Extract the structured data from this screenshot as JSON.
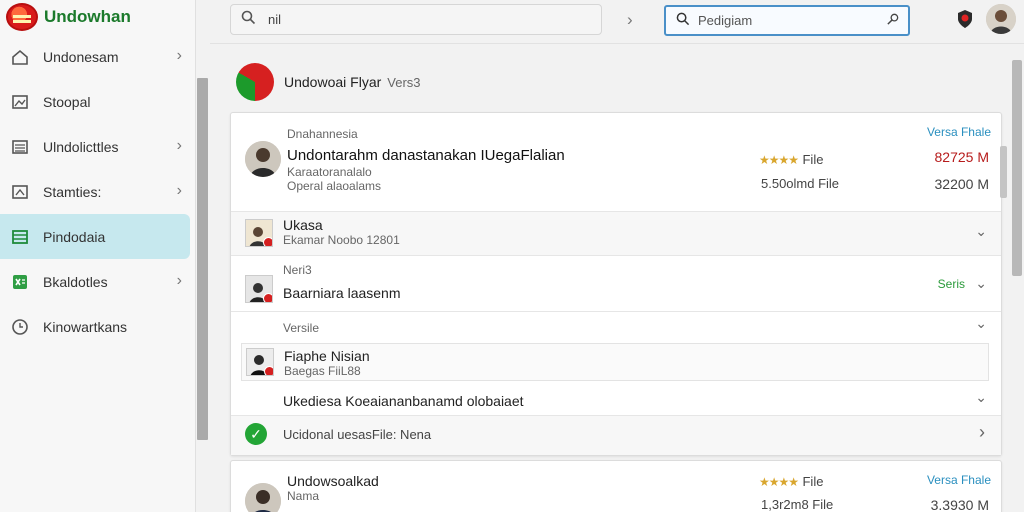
{
  "app": {
    "name": "Undowhan"
  },
  "sidebar": {
    "items": [
      {
        "label": "Undonesam",
        "icon": "home-icon",
        "chevron": true
      },
      {
        "label": "Stoopal",
        "icon": "image-icon",
        "chevron": false
      },
      {
        "label": "Ulndolicttles",
        "icon": "list-icon",
        "chevron": true
      },
      {
        "label": "Stamties:",
        "icon": "photo-icon",
        "chevron": true
      },
      {
        "label": "Pindodaia",
        "icon": "table-icon",
        "chevron": false,
        "active": true
      },
      {
        "label": "Bkaldotles",
        "icon": "spreadsheet-icon",
        "chevron": true
      },
      {
        "label": "Kinowartkans",
        "icon": "clock-icon",
        "chevron": false
      }
    ]
  },
  "topbar": {
    "search_left_value": "nil",
    "search_right_value": "Pedigiam"
  },
  "header": {
    "title": "Undowoai Flyar",
    "version": "Vers3"
  },
  "card1": {
    "top": {
      "small_title": "Dnahannesia",
      "main_title": "Undontarahm danastanakan IUegaFlalian",
      "sub1": "Karaatoranalalo",
      "sub2": "Operal alaoalams",
      "rating_label": "File",
      "size_label": "5.50olmd File",
      "version_link": "Versa Fhale",
      "red_value": "82725 M",
      "grey_value": "32200 M"
    },
    "row1": {
      "title": "Ukasa",
      "sub": "Ekamar Noobo 12801"
    },
    "row2": {
      "kicker": "Neri3",
      "title": "Baarniara laasenm",
      "right_label": "Seris"
    },
    "row3": {
      "label": "Versile"
    },
    "row4": {
      "title": "Fiaphe Nisian",
      "sub": "Baegas FiiL88"
    },
    "row5": {
      "label": "Ukediesa Koeaiananbanamd olobaiaet"
    },
    "row6": {
      "label": "Ucidonal uesasFile: Nena"
    }
  },
  "card2": {
    "title": "Undowsoalkad",
    "sub": "Nama",
    "rating_label": "File",
    "size_label": "1,3r2m8 File",
    "version_link": "Versa Fhale",
    "grey_value": "3.3930 M"
  },
  "colors": {
    "brand_green": "#1b7a2b",
    "active_nav": "#c6e8ee",
    "link_teal": "#2a8fbf",
    "value_red": "#b71c1c",
    "check_green": "#23a536"
  }
}
